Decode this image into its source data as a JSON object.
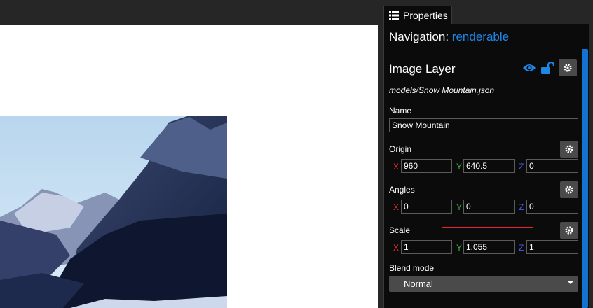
{
  "panel": {
    "tab_label": "Properties",
    "navigation_label": "Navigation:",
    "navigation_value": "renderable",
    "layer_title": "Image Layer",
    "file_path": "models/Snow Mountain.json",
    "name_label": "Name",
    "name_value": "Snow Mountain",
    "origin": {
      "label": "Origin",
      "x": "960",
      "y": "640.5",
      "z": "0"
    },
    "angles": {
      "label": "Angles",
      "x": "0",
      "y": "0",
      "z": "0"
    },
    "scale": {
      "label": "Scale",
      "x": "1",
      "y": "1.055",
      "z": "1"
    },
    "axis_labels": {
      "x": "X",
      "y": "Y",
      "z": "Z"
    },
    "blend_mode_label": "Blend mode",
    "blend_mode_value": "Normal"
  },
  "colors": {
    "accent": "#1f86e6",
    "panel_bg": "#0b0b0b",
    "axis_x": "#e02f2f",
    "axis_y": "#3cb043",
    "axis_z": "#4a5ce8",
    "highlight": "#e0262a"
  },
  "icons": [
    "list-icon",
    "eye-icon",
    "lock-open-icon",
    "gear-icon",
    "caret-down-icon"
  ]
}
